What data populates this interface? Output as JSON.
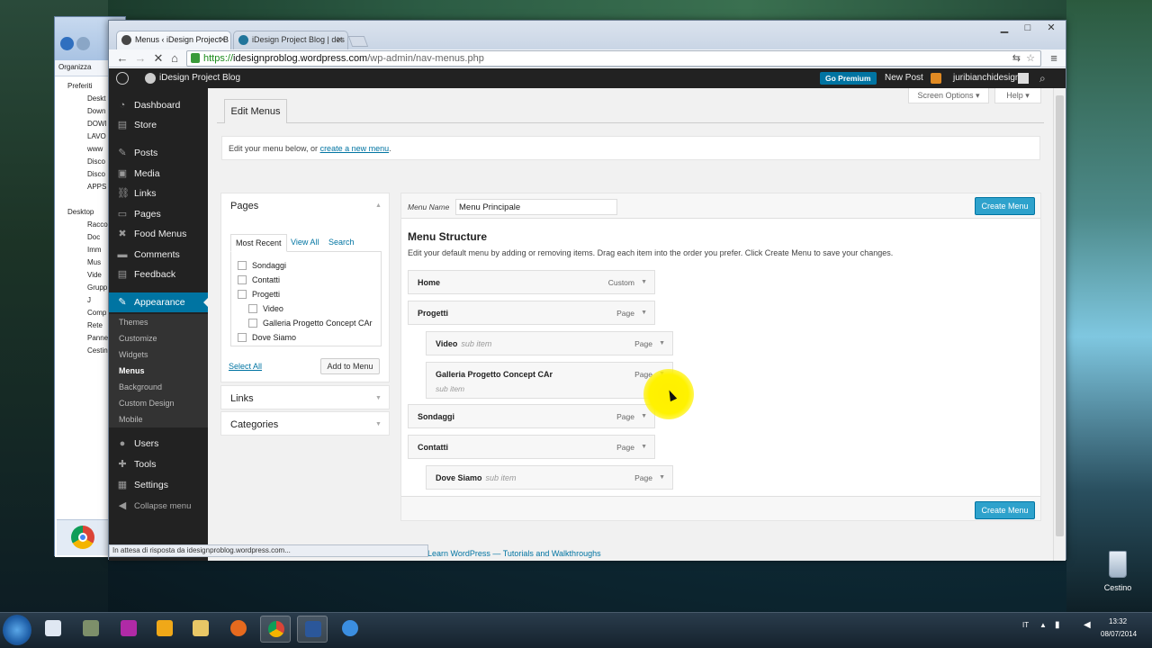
{
  "browser": {
    "tabs": [
      {
        "label": "Menus ‹ iDesign Project B",
        "active": true
      },
      {
        "label": "iDesign Project Blog | des",
        "active": false
      }
    ],
    "url_https": "https://",
    "url_host": "idesignproblog.wordpress.com",
    "url_path": "/wp-admin/nav-menus.php",
    "status": "In attesa di risposta da idesignproblog.wordpress.com...",
    "window_controls": [
      "▁",
      "□",
      "✕"
    ]
  },
  "explorer": {
    "organize": "Organizza",
    "tree": [
      "Preferiti",
      "Deskt",
      "Down",
      "DOWI",
      "LAVO",
      "www",
      "Disco",
      "Disco",
      "APPS",
      "",
      "Desktop",
      "Racco",
      "Doc",
      "Imm",
      "Mus",
      "Vide",
      "Grupp",
      "J",
      "Comp",
      "Rete",
      "Panne",
      "Cestin"
    ]
  },
  "adminbar": {
    "site_name": "iDesign Project Blog",
    "go_premium": "Go Premium",
    "new_post": "New Post",
    "user": "juribianchidesign"
  },
  "menu": {
    "items": [
      {
        "label": "Dashboard",
        "icon": "◔"
      },
      {
        "label": "Store",
        "icon": "▤"
      },
      {
        "label": "Posts",
        "icon": "✎"
      },
      {
        "label": "Media",
        "icon": "▣"
      },
      {
        "label": "Links",
        "icon": "⛓"
      },
      {
        "label": "Pages",
        "icon": "▭"
      },
      {
        "label": "Food Menus",
        "icon": "✖"
      },
      {
        "label": "Comments",
        "icon": "▬"
      },
      {
        "label": "Feedback",
        "icon": "▤"
      },
      {
        "label": "Appearance",
        "icon": "✎"
      },
      {
        "label": "Users",
        "icon": "●"
      },
      {
        "label": "Tools",
        "icon": "✚"
      },
      {
        "label": "Settings",
        "icon": "▦"
      },
      {
        "label": "Collapse menu",
        "icon": "◀"
      }
    ],
    "appearance_sub": [
      "Themes",
      "Customize",
      "Widgets",
      "Menus",
      "Background",
      "Custom Design",
      "Mobile"
    ]
  },
  "screen": {
    "screen_options": "Screen Options ▾",
    "help": "Help ▾",
    "edit_tab": "Edit Menus",
    "notice_prefix": "Edit your menu below, or ",
    "notice_link": "create a new menu",
    "notice_suffix": "."
  },
  "left": {
    "pages_title": "Pages",
    "tabs": [
      "Most Recent",
      "View All",
      "Search"
    ],
    "pages": [
      "Sondaggi",
      "Contatti",
      "Progetti",
      "Video",
      "Galleria Progetto Concept CAr",
      "Dove Siamo"
    ],
    "select_all": "Select All",
    "add_to_menu": "Add to Menu",
    "links_title": "Links",
    "categories_title": "Categories"
  },
  "right": {
    "menu_name_label": "Menu Name",
    "menu_name_value": "Menu Principale",
    "create_menu": "Create Menu",
    "structure_title": "Menu Structure",
    "structure_desc": "Edit your default menu by adding or removing items. Drag each item into the order you prefer. Click Create Menu to save your changes.",
    "items": [
      {
        "title": "Home",
        "sub": "",
        "type": "Custom"
      },
      {
        "title": "Progetti",
        "sub": "",
        "type": "Page"
      },
      {
        "title": "Video",
        "sub": "sub item",
        "type": "Page"
      },
      {
        "title": "Galleria Progetto Concept CAr",
        "sub": "sub item",
        "type": "Page"
      },
      {
        "title": "Sondaggi",
        "sub": "",
        "type": "Page"
      },
      {
        "title": "Contatti",
        "sub": "",
        "type": "Page"
      },
      {
        "title": "Dove Siamo",
        "sub": "sub item",
        "type": "Page"
      }
    ]
  },
  "footer": {
    "link": "Learn WordPress — Tutorials and Walkthroughs"
  },
  "taskbar": {
    "lang": "IT",
    "time": "13:32",
    "date": "08/07/2014",
    "recycle_bin": "Cestino"
  }
}
